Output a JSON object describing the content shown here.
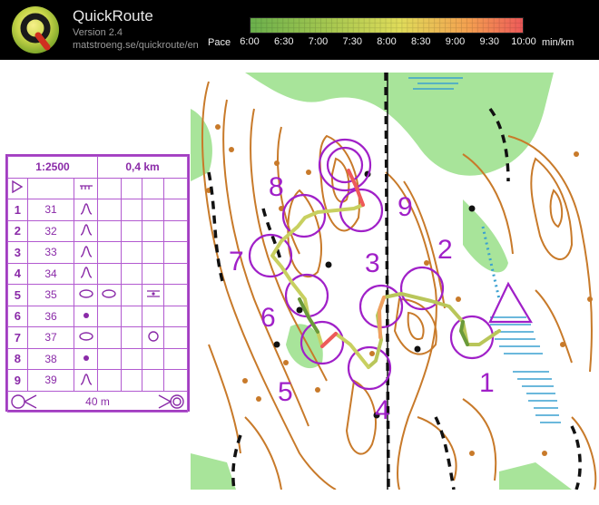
{
  "app": {
    "title": "QuickRoute",
    "version": "Version 2.4",
    "url": "matstroeng.se/quickroute/en"
  },
  "pace_legend": {
    "label": "Pace",
    "ticks": [
      "6:00",
      "6:30",
      "7:00",
      "7:30",
      "8:00",
      "8:30",
      "9:00",
      "9:30",
      "10:00"
    ],
    "unit": "min/km",
    "gradient": [
      "#6ab04c",
      "#a8c850",
      "#e0dc5a",
      "#f4a050",
      "#ee5a5a"
    ]
  },
  "control_description": {
    "scale": "1:2500",
    "length": "0,4 km",
    "rows": [
      {
        "num": "1",
        "code": "31"
      },
      {
        "num": "2",
        "code": "32"
      },
      {
        "num": "3",
        "code": "33"
      },
      {
        "num": "4",
        "code": "34"
      },
      {
        "num": "5",
        "code": "35"
      },
      {
        "num": "6",
        "code": "36"
      },
      {
        "num": "7",
        "code": "37"
      },
      {
        "num": "8",
        "code": "38"
      },
      {
        "num": "9",
        "code": "39"
      }
    ],
    "finish_distance": "40 m"
  },
  "map": {
    "control_labels": [
      "1",
      "2",
      "3",
      "4",
      "5",
      "6",
      "7",
      "8",
      "9"
    ],
    "colors": {
      "course": "#a020c8",
      "contour": "#c87a2a",
      "vegetation": "#9fe08f",
      "water": "#3aa0d0"
    }
  }
}
